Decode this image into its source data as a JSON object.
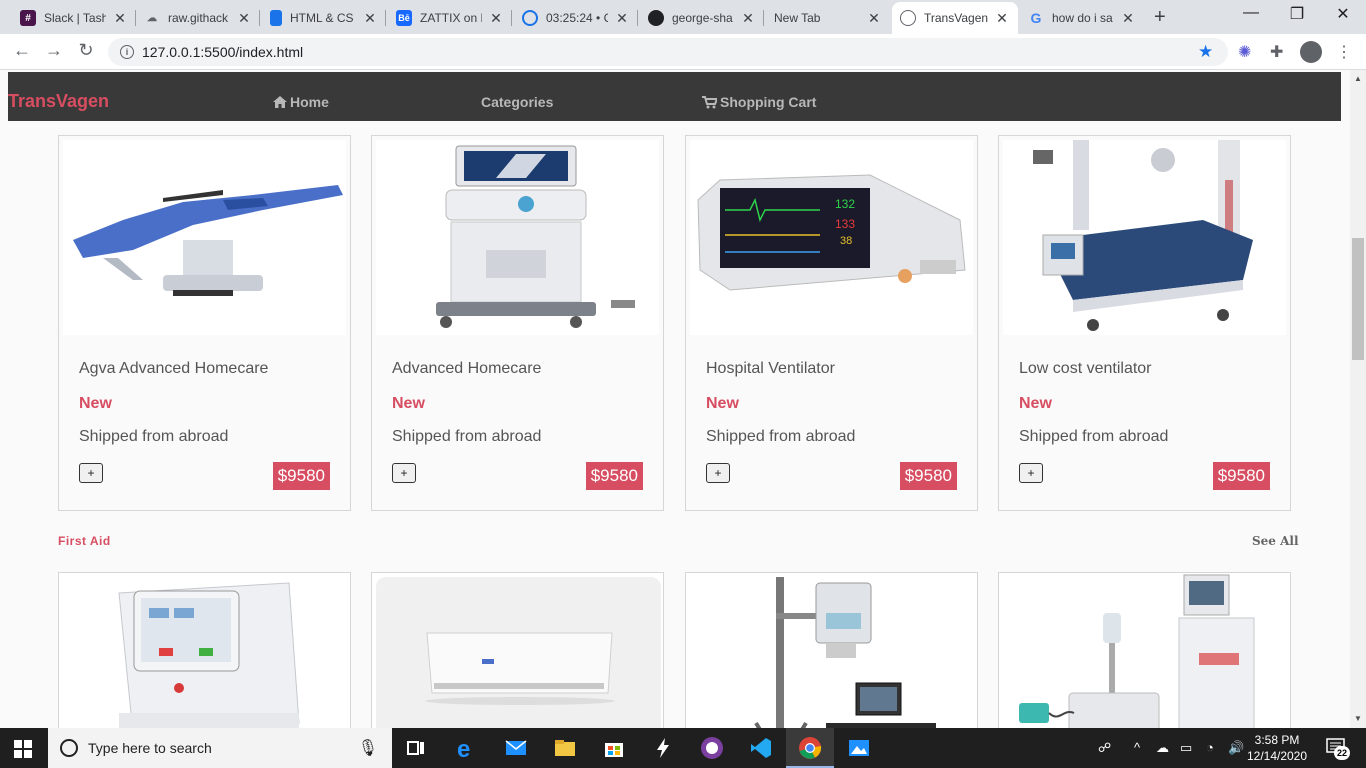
{
  "browser": {
    "tabs": [
      {
        "title": "Slack | Tash",
        "icon": "slack-icon",
        "color": "#4a154b"
      },
      {
        "title": "raw.githack",
        "icon": "githack-icon",
        "color": "#9aa0a6"
      },
      {
        "title": "HTML & CS",
        "icon": "mobile-icon",
        "color": "#1a73e8"
      },
      {
        "title": "ZATTIX on B",
        "icon": "behance-icon",
        "color": "#1769ff"
      },
      {
        "title": "03:25:24 • C",
        "icon": "clock-icon",
        "color": "#1a73e8"
      },
      {
        "title": "george-sha",
        "icon": "github-icon",
        "color": "#202124"
      },
      {
        "title": "New Tab",
        "icon": "",
        "color": ""
      },
      {
        "title": "TransVagen",
        "icon": "globe-icon",
        "color": "#5f6368"
      },
      {
        "title": "how do i sa",
        "icon": "google-icon",
        "color": "#4285f4"
      }
    ],
    "url": "127.0.0.1:5500/index.html"
  },
  "site": {
    "brand": "TransVagen",
    "nav": {
      "home": "Home",
      "categories": "Categories",
      "cart": "Shopping Cart"
    },
    "accent_color": "#d74d61"
  },
  "products": [
    {
      "name": "Agva Advanced Homecare",
      "badge": "New",
      "shipping": "Shipped from abroad",
      "add_label": "+",
      "price": "$9580",
      "image": "dental-chair-image"
    },
    {
      "name": "Advanced Homecare",
      "badge": "New",
      "shipping": "Shipped from abroad",
      "add_label": "+",
      "price": "$9580",
      "image": "ultrasound-cart-image"
    },
    {
      "name": "Hospital Ventilator",
      "badge": "New",
      "shipping": "Shipped from abroad",
      "add_label": "+",
      "price": "$9580",
      "image": "patient-monitor-image"
    },
    {
      "name": "Low cost ventilator",
      "badge": "New",
      "shipping": "Shipped from abroad",
      "add_label": "+",
      "price": "$9580",
      "image": "icu-bed-image"
    }
  ],
  "section": {
    "title": "First Aid",
    "see_all": "See All"
  },
  "taskbar": {
    "search_placeholder": "Type here to search",
    "time": "3:58 PM",
    "date": "12/14/2020",
    "notifications": "22"
  }
}
